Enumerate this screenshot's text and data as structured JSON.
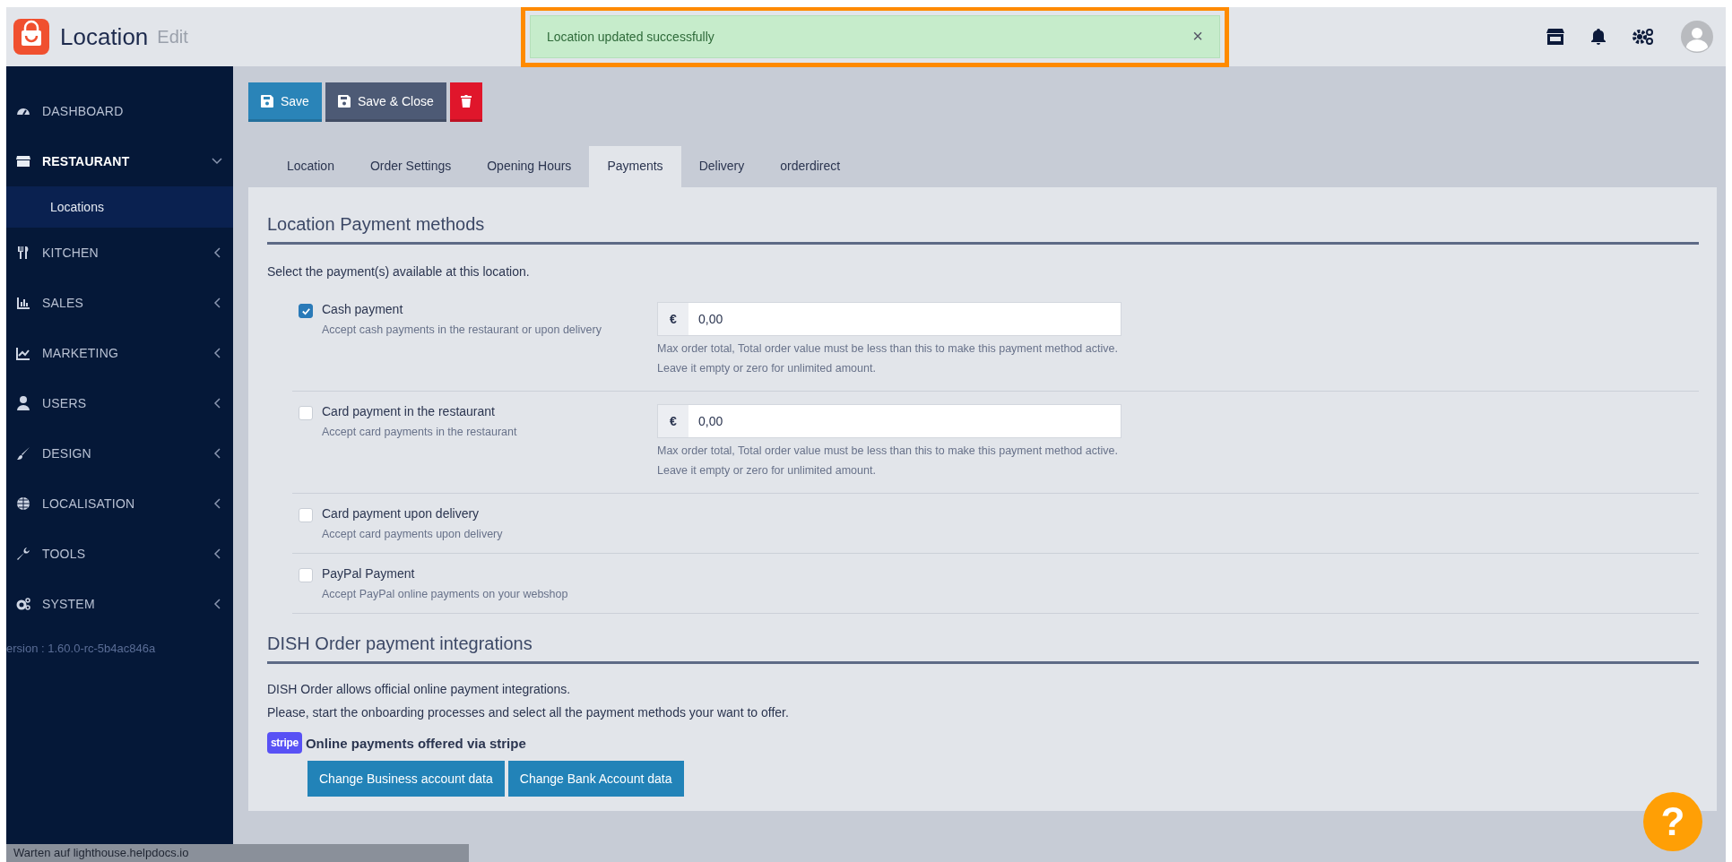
{
  "header": {
    "title": "Location",
    "subtitle": "Edit"
  },
  "toast": {
    "message": "Location updated successfully",
    "close": "×",
    "highlighted": true
  },
  "sidebar": {
    "items": [
      {
        "label": "DASHBOARD",
        "expanded": false,
        "has_children": false
      },
      {
        "label": "RESTAURANT",
        "expanded": true,
        "has_children": true,
        "children": [
          {
            "label": "Locations",
            "selected": true
          }
        ]
      },
      {
        "label": "KITCHEN",
        "expanded": false,
        "has_children": true
      },
      {
        "label": "SALES",
        "expanded": false,
        "has_children": true
      },
      {
        "label": "MARKETING",
        "expanded": false,
        "has_children": true
      },
      {
        "label": "USERS",
        "expanded": false,
        "has_children": true
      },
      {
        "label": "DESIGN",
        "expanded": false,
        "has_children": true
      },
      {
        "label": "LOCALISATION",
        "expanded": false,
        "has_children": true
      },
      {
        "label": "TOOLS",
        "expanded": false,
        "has_children": true
      },
      {
        "label": "SYSTEM",
        "expanded": false,
        "has_children": true
      }
    ],
    "version": "ersion : 1.60.0-rc-5b4ac846a"
  },
  "toolbar": {
    "save": "Save",
    "save_close": "Save & Close"
  },
  "tabs": [
    {
      "label": "Location",
      "selected": false
    },
    {
      "label": "Order Settings",
      "selected": false
    },
    {
      "label": "Opening Hours",
      "selected": false
    },
    {
      "label": "Payments",
      "selected": true
    },
    {
      "label": "Delivery",
      "selected": false
    },
    {
      "label": "orderdirect",
      "selected": false
    }
  ],
  "payment_section": {
    "title": "Location Payment methods",
    "intro": "Select the payment(s) available at this location.",
    "methods": [
      {
        "name": "Cash payment",
        "description": "Accept cash payments in the restaurant or upon delivery",
        "checked": true,
        "max_total": {
          "currency": "€",
          "value": "0,00",
          "help": "Max order total, Total order value must be less than this to make this payment method active. Leave it empty or zero for unlimited amount."
        }
      },
      {
        "name": "Card payment in the restaurant",
        "description": "Accept card payments in the restaurant",
        "checked": false,
        "max_total": {
          "currency": "€",
          "value": "0,00",
          "help": "Max order total, Total order value must be less than this to make this payment method active. Leave it empty or zero for unlimited amount."
        }
      },
      {
        "name": "Card payment upon delivery",
        "description": "Accept card payments upon delivery",
        "checked": false
      },
      {
        "name": "PayPal Payment",
        "description": "Accept PayPal online payments on your webshop",
        "checked": false
      }
    ]
  },
  "integration_section": {
    "title": "DISH Order payment integrations",
    "paragraphs": [
      "DISH Order allows official online payment integrations.",
      "Please, start the onboarding processes and select all the payment methods your want to offer."
    ],
    "stripe": {
      "badge": "stripe",
      "label": "Online payments offered via stripe"
    },
    "buttons": [
      "Change Business account data",
      "Change Bank Account data"
    ]
  },
  "help_button": "?",
  "status_bar": "Warten auf lighthouse.helpdocs.io"
}
